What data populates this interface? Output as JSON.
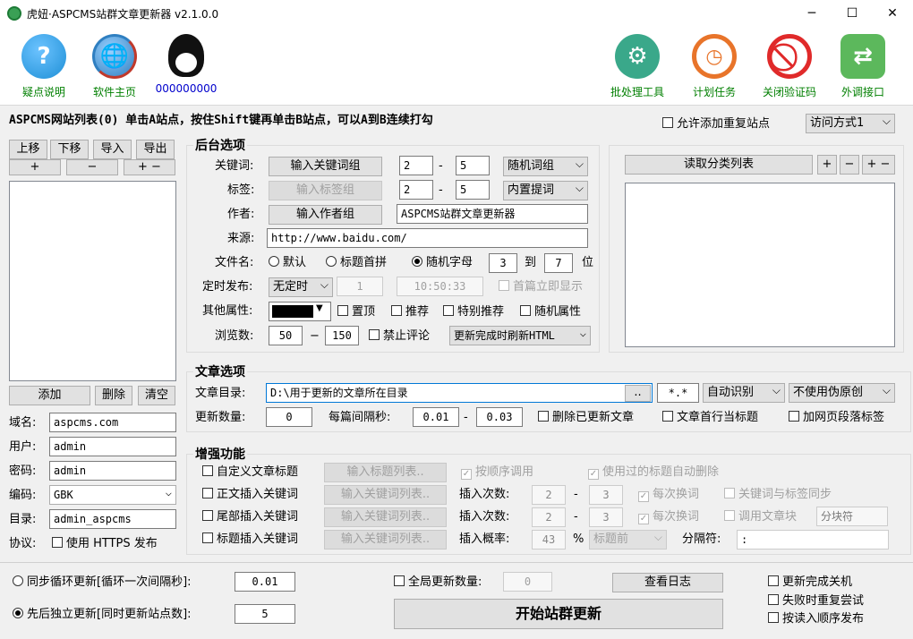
{
  "window": {
    "title": "虎妞·ASPCMS站群文章更新器 v2.1.0.0",
    "minimize": "─",
    "maximize": "☐",
    "close": "✕"
  },
  "toolbar": {
    "help": "疑点说明",
    "home": "软件主页",
    "qq": "000000000",
    "batch": "批处理工具",
    "schedule": "计划任务",
    "close_captcha": "关闭验证码",
    "external": "外调接口"
  },
  "site_list": {
    "title": "ASPCMS网站列表(0)  单击A站点，按住Shift键再单击B站点，可以A到B连续打勾",
    "allow_dup": "允许添加重复站点",
    "access_mode": "访问方式1"
  },
  "left": {
    "up": "上移",
    "down": "下移",
    "import": "导入",
    "export": "导出",
    "plus": "+",
    "minus": "−",
    "plusminus": "+ −",
    "add": "添加",
    "delete": "删除",
    "clear": "清空",
    "domain_label": "域名:",
    "domain": "aspcms.com",
    "user_label": "用户:",
    "user": "admin",
    "pwd_label": "密码:",
    "pwd": "admin",
    "enc_label": "编码:",
    "enc": "GBK",
    "dir_label": "目录:",
    "dir": "admin_aspcms",
    "proto_label": "协议:",
    "https": "使用 HTTPS 发布"
  },
  "backend": {
    "title": "后台选项",
    "kw_label": "关键词:",
    "kw_btn": "输入关键词组",
    "kw_min": "2",
    "kw_max": "5",
    "kw_mode": "随机词组",
    "tag_label": "标签:",
    "tag_btn": "输入标签组",
    "tag_min": "2",
    "tag_max": "5",
    "tag_mode": "内置提词",
    "author_label": "作者:",
    "author_btn": "输入作者组",
    "author": "ASPCMS站群文章更新器",
    "source_label": "来源:",
    "source": "http://www.baidu.com/",
    "fname_label": "文件名:",
    "fname_default": "默认",
    "fname_pinyin": "标题首拼",
    "fname_random": "随机字母",
    "fname_min": "3",
    "fname_to": "到",
    "fname_max": "7",
    "fname_unit": "位",
    "timed_label": "定时发布:",
    "timed_mode": "无定时",
    "timed_n": "1",
    "timed_time": "10:50:33",
    "timed_first": "首篇立即显示",
    "other_label": "其他属性:",
    "other_top": "置顶",
    "other_rec": "推荐",
    "other_srec": "特别推荐",
    "other_rand": "随机属性",
    "views_label": "浏览数:",
    "views_min": "50",
    "views_max": "150",
    "no_comment": "禁止评论",
    "refresh_mode": "更新完成时刷新HTML",
    "dash": "-",
    "dash2": "−"
  },
  "category": {
    "read_btn": "读取分类列表",
    "plus": "+",
    "minus": "−",
    "plusminus": "+ −"
  },
  "article": {
    "title": "文章选项",
    "dir_label": "文章目录:",
    "dir": "D:\\用于更新的文章所在目录",
    "browse": "..",
    "ext": "*.*",
    "enc": "自动识别",
    "pseudo": "不使用伪原创",
    "count_label": "更新数量:",
    "count": "0",
    "interval_label": "每篇间隔秒:",
    "int_min": "0.01",
    "int_max": "0.03",
    "del_updated": "删除已更新文章",
    "first_line_title": "文章首行当标题",
    "add_para_tag": "加网页段落标签"
  },
  "enhance": {
    "title": "增强功能",
    "custom_title": "自定义文章标题",
    "title_list_btn": "输入标题列表..",
    "seq_call": "按顺序调用",
    "auto_del_used": "使用过的标题自动删除",
    "body_kw": "正文插入关键词",
    "body_kw_btn": "输入关键词列表..",
    "ins_times_label": "插入次数:",
    "body_min": "2",
    "body_max": "3",
    "every_change": "每次换词",
    "sync_kw_tag": "关键词与标签同步",
    "tail_kw": "尾部插入关键词",
    "tail_kw_btn": "输入关键词列表..",
    "tail_min": "2",
    "tail_max": "3",
    "call_block": "调用文章块",
    "block_sep": "分块符",
    "title_kw": "标题插入关键词",
    "title_kw_btn": "输入关键词列表..",
    "ins_prob_label": "插入概率:",
    "prob": "43",
    "pct": "%",
    "pos": "标题前",
    "sep_label": "分隔符:",
    "sep": ":"
  },
  "bottom": {
    "sync_loop": "同步循环更新[循环一次间隔秒]:",
    "sync_val": "0.01",
    "seq_update": "先后独立更新[同时更新站点数]:",
    "seq_val": "5",
    "global_count": "全局更新数量:",
    "global_val": "0",
    "view_log": "查看日志",
    "start": "开始站群更新",
    "shutdown": "更新完成关机",
    "retry": "失败时重复尝试",
    "order_pub": "按读入顺序发布"
  },
  "colors": {
    "help": "#1e8fd6",
    "globe": "#2f7fc1",
    "gear": "#3aa88a",
    "clock": "#e8742a",
    "stop": "#e02a2a",
    "arrow": "#5cb85c"
  }
}
